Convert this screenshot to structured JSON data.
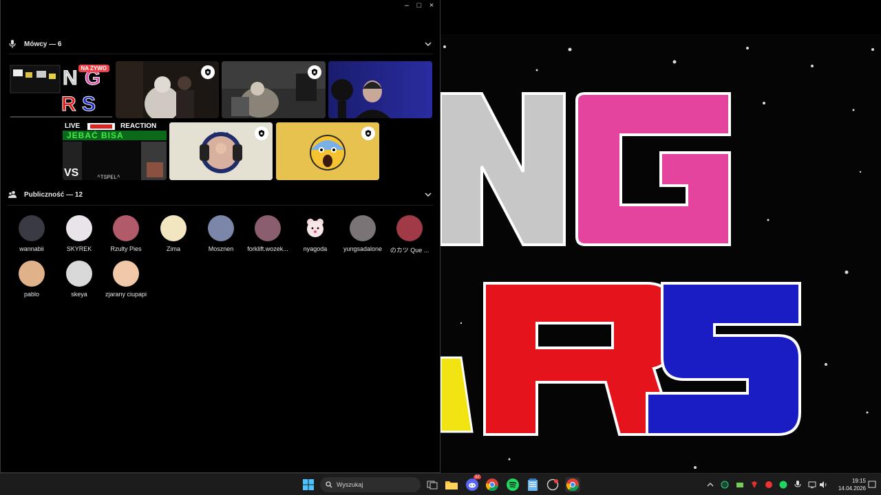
{
  "window": {
    "minimize": "–",
    "maximize": "□",
    "close": "×"
  },
  "speakers": {
    "title": "Mówcy — 6",
    "live_badge": "NA ŻYWO",
    "reaction_banner": {
      "live": "LIVE",
      "reaction": "REACTION",
      "caption": "JEBAĆ BISA"
    }
  },
  "audience": {
    "title": "Publiczność — 12",
    "members": [
      {
        "name": "wannabii",
        "color": "#3a3a44"
      },
      {
        "name": "SKYREK",
        "color": "#e9e4ea"
      },
      {
        "name": "Rzulty Pies",
        "color": "#b05a6a"
      },
      {
        "name": "Zima",
        "color": "#f1e6c0"
      },
      {
        "name": "Mosznen",
        "color": "#7b86a8"
      },
      {
        "name": "forklift.wozek...",
        "color": "#8a5e6e"
      },
      {
        "name": "nyagoda",
        "color": "#000000"
      },
      {
        "name": "yungsadalone",
        "color": "#7a7476"
      },
      {
        "name": "のカツ Que ...",
        "color": "#a13a47"
      },
      {
        "name": "pablo",
        "color": "#e0b28a"
      },
      {
        "name": "skeya",
        "color": "#d9d9d9"
      },
      {
        "name": "zjarany ciupapi",
        "color": "#f1c9a8"
      }
    ]
  },
  "taskbar": {
    "search_placeholder": "Wyszukaj",
    "discord_badge": "57",
    "time": "19:15",
    "date": "14.04.2026"
  },
  "colors": {
    "accent_red": "#ed4245",
    "yellow_tile": "#e8c24f",
    "beige_tile": "#e4e1d3"
  }
}
